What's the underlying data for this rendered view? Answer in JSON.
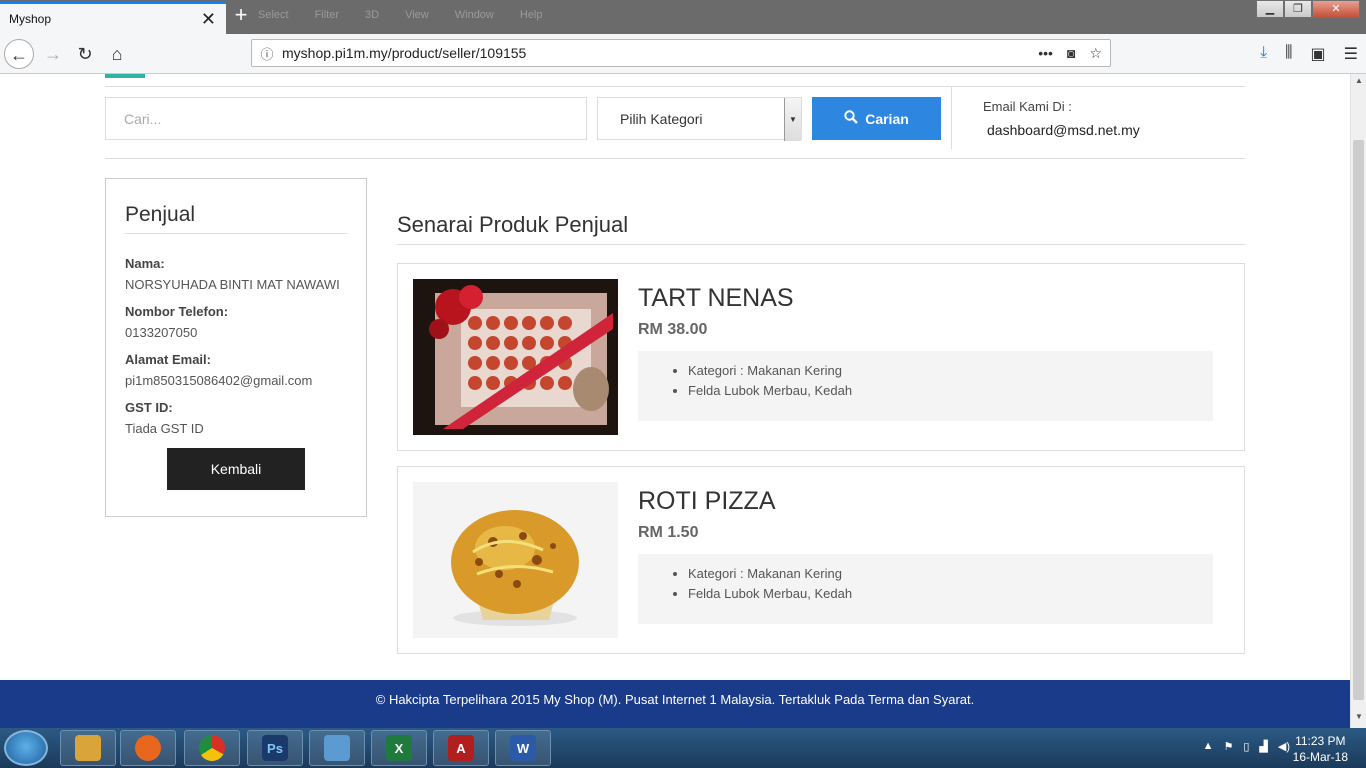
{
  "browser": {
    "tab_title": "Myshop",
    "tab_close": "✕",
    "newtab": "+",
    "menu_faded": [
      "Select",
      "Filter",
      "3D",
      "View",
      "Window",
      "Help"
    ],
    "url": "myshop.pi1m.my/product/seller/109155"
  },
  "header": {
    "search_placeholder": "Cari...",
    "category_selected": "Pilih Kategori",
    "search_button": "Carian",
    "email_label": "Email Kami Di :",
    "email_value": "dashboard@msd.net.my"
  },
  "seller": {
    "title": "Penjual",
    "fields": [
      {
        "label": "Nama:",
        "value": "NORSYUHADA BINTI MAT NAWAWI"
      },
      {
        "label": "Nombor Telefon:",
        "value": "0133207050"
      },
      {
        "label": "Alamat Email:",
        "value": "pi1m850315086402@gmail.com"
      },
      {
        "label": "GST ID:",
        "value": "Tiada GST ID"
      }
    ],
    "back_button": "Kembali"
  },
  "products": {
    "title": "Senarai Produk Penjual",
    "items": [
      {
        "name": "TART NENAS",
        "price": "RM 38.00",
        "category": "Kategori : Makanan Kering",
        "location": "Felda Lubok Merbau, Kedah"
      },
      {
        "name": "ROTI PIZZA",
        "price": "RM 1.50",
        "category": "Kategori : Makanan Kering",
        "location": "Felda Lubok Merbau, Kedah"
      }
    ]
  },
  "footer": {
    "text": "© Hakcipta Terpelihara 2015 My Shop (M). Pusat Internet 1 Malaysia. Tertakluk Pada Terma dan Syarat."
  },
  "taskbar": {
    "apps": [
      {
        "name": "explorer",
        "label": "",
        "color": "#d9a43a"
      },
      {
        "name": "firefox",
        "label": "",
        "color": "#e8661e"
      },
      {
        "name": "chrome",
        "label": "",
        "color": "#4aa14a"
      },
      {
        "name": "photoshop",
        "label": "Ps",
        "color": "#1b3a6b"
      },
      {
        "name": "photo-viewer",
        "label": "",
        "color": "#5c9bd1"
      },
      {
        "name": "excel",
        "label": "X",
        "color": "#1f7a3d"
      },
      {
        "name": "acrobat",
        "label": "A",
        "color": "#b01e1e"
      },
      {
        "name": "word",
        "label": "W",
        "color": "#2a5aa8"
      }
    ],
    "time": "11:23 PM",
    "date": "16-Mar-18"
  },
  "colors": {
    "accent_blue": "#2d86e0",
    "footer_blue": "#1a3a8a",
    "button_dark": "#222222"
  }
}
